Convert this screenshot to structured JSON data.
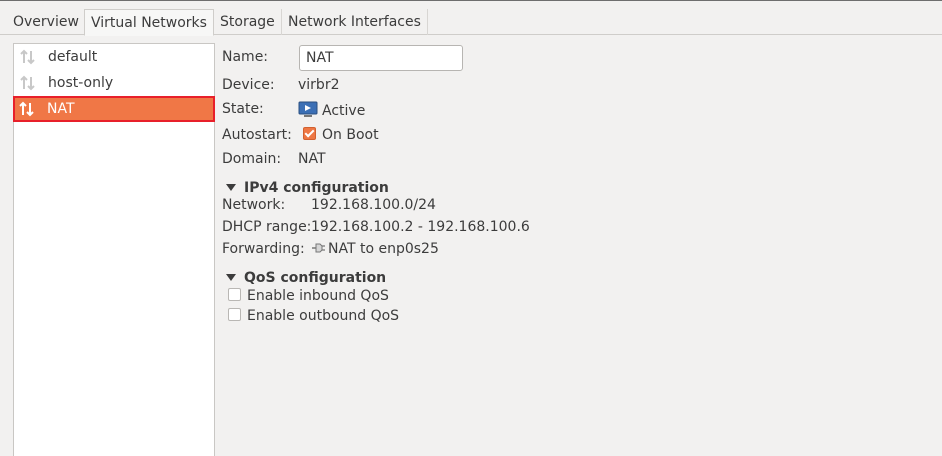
{
  "tabs": [
    {
      "label": "Overview"
    },
    {
      "label": "Virtual Networks"
    },
    {
      "label": "Storage"
    },
    {
      "label": "Network Interfaces"
    }
  ],
  "active_tab": "Virtual Networks",
  "networks": [
    {
      "name": "default",
      "icon": "network-updown-icon"
    },
    {
      "name": "host-only",
      "icon": "network-updown-icon"
    },
    {
      "name": "NAT",
      "icon": "network-updown-icon"
    }
  ],
  "selected_network": "NAT",
  "details": {
    "name_label": "Name:",
    "name_value": "NAT",
    "device_label": "Device:",
    "device_value": "virbr2",
    "state_label": "State:",
    "state_value": "Active",
    "autostart_label": "Autostart:",
    "autostart_value": "On Boot",
    "domain_label": "Domain:",
    "domain_value": "NAT"
  },
  "ipv4": {
    "header": "IPv4 configuration",
    "network_label": "Network:",
    "network_value": "192.168.100.0/24",
    "dhcp_label": "DHCP range:",
    "dhcp_value": "192.168.100.2 - 192.168.100.6",
    "forwarding_label": "Forwarding:",
    "forwarding_value": "NAT to enp0s25"
  },
  "qos": {
    "header": "QoS configuration",
    "inbound_label": "Enable inbound QoS",
    "outbound_label": "Enable outbound QoS"
  },
  "colors": {
    "selection": "#f07746",
    "highlight_border": "#e8202a",
    "checkbox_checked": "#ee7744"
  }
}
